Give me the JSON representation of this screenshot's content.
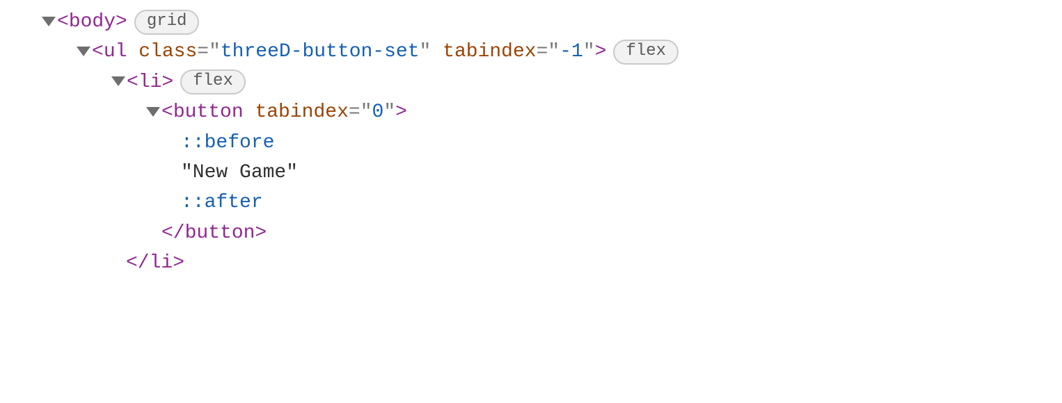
{
  "rows": [
    {
      "indent": "indent-0",
      "arrow": true,
      "parts": [
        "<",
        "body",
        ">"
      ],
      "badge": "grid",
      "closeAfter": null,
      "type": "open-tag-simple"
    }
  ],
  "elements": {
    "body": {
      "tagOpen": "<",
      "tagName": "body",
      "tagClose": ">",
      "badge": "grid"
    },
    "ul": {
      "tagOpen": "<",
      "tagName": "ul",
      "space": " ",
      "attr1Name": "class",
      "eq": "=",
      "q": "\"",
      "attr1Value": "threeD-button-set",
      "attr2Name": "tabindex",
      "attr2Value": "-1",
      "tagClose": ">",
      "badge": "flex"
    },
    "li": {
      "tagOpen": "<",
      "tagName": "li",
      "tagClose": ">",
      "badge": "flex",
      "closeTag": "</li>"
    },
    "button": {
      "tagOpen": "<",
      "tagName": "button",
      "space": " ",
      "attr1Name": "tabindex",
      "eq": "=",
      "q": "\"",
      "attr1Value": "0",
      "tagClose": ">",
      "closeTag": "</button>"
    },
    "pseudoBefore": "::before",
    "textNode": "\"New Game\"",
    "pseudoAfter": "::after"
  }
}
